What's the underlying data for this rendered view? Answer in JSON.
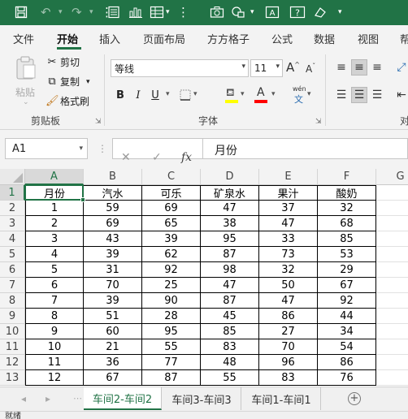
{
  "qat": {
    "icons": [
      "save-icon",
      "undo-icon",
      "redo-icon",
      "form-icon",
      "chart-icon",
      "table-icon",
      "camera-icon",
      "shapes-icon",
      "text-box-icon",
      "help-icon",
      "customize-icon"
    ]
  },
  "tabs": [
    "文件",
    "开始",
    "插入",
    "页面布局",
    "方方格子",
    "公式",
    "数据",
    "视图",
    "帮"
  ],
  "ribbon": {
    "clipboard": {
      "paste": "粘贴",
      "cut": "剪切",
      "copy": "复制",
      "format_painter": "格式刷",
      "label": "剪贴板"
    },
    "font": {
      "name": "等线",
      "size": "11",
      "label": "字体",
      "increase": "A",
      "decrease": "A",
      "bold": "B",
      "italic": "I",
      "underline": "U",
      "pinyin": "wén"
    },
    "alignment": {
      "label": "对"
    }
  },
  "formula_bar": {
    "name_box": "A1",
    "cancel": "✕",
    "enter": "✓",
    "fx": "fx",
    "formula": "月份"
  },
  "columns": [
    "A",
    "B",
    "C",
    "D",
    "E",
    "F",
    "G"
  ],
  "rows": [
    "1",
    "2",
    "3",
    "4",
    "5",
    "6",
    "7",
    "8",
    "9",
    "10",
    "11",
    "12",
    "13"
  ],
  "table": {
    "headers": [
      "月份",
      "汽水",
      "可乐",
      "矿泉水",
      "果汁",
      "酸奶"
    ],
    "data": [
      [
        "1",
        "59",
        "69",
        "47",
        "37",
        "32"
      ],
      [
        "2",
        "69",
        "65",
        "38",
        "47",
        "68"
      ],
      [
        "3",
        "43",
        "39",
        "95",
        "33",
        "85"
      ],
      [
        "4",
        "39",
        "62",
        "87",
        "73",
        "53"
      ],
      [
        "5",
        "31",
        "92",
        "98",
        "32",
        "29"
      ],
      [
        "6",
        "70",
        "25",
        "47",
        "50",
        "67"
      ],
      [
        "7",
        "39",
        "90",
        "87",
        "47",
        "92"
      ],
      [
        "8",
        "51",
        "28",
        "45",
        "86",
        "44"
      ],
      [
        "9",
        "60",
        "95",
        "85",
        "27",
        "34"
      ],
      [
        "10",
        "21",
        "55",
        "83",
        "70",
        "54"
      ],
      [
        "11",
        "36",
        "77",
        "48",
        "96",
        "86"
      ],
      [
        "12",
        "67",
        "87",
        "55",
        "83",
        "76"
      ]
    ]
  },
  "sheets": [
    "车间2-车间2",
    "车间3-车间3",
    "车间1-车间1"
  ],
  "add_sheet": "+",
  "status_text": "就绪",
  "colors": {
    "accent": "#217346",
    "ribbon_bg": "#f3f3f3",
    "fill_yellow": "#ffff00",
    "font_red": "#ff0000"
  }
}
